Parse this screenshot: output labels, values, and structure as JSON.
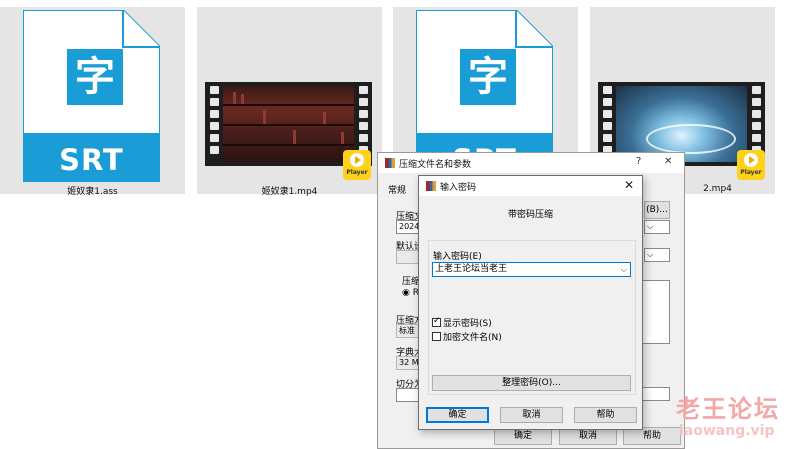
{
  "files": [
    {
      "name": "姬奴隶1.ass",
      "type_char": "字",
      "type_label": "SRT"
    },
    {
      "name": "姬奴隶1.mp4",
      "badge": "Player"
    },
    {
      "name": "",
      "type_char": "字",
      "type_label": "SRT"
    },
    {
      "name": "2.mp4",
      "badge": "Player"
    }
  ],
  "archive_dialog": {
    "title": "压缩文件名和参数",
    "help_glyph": "?",
    "close_glyph": "✕",
    "tab_general": "常规",
    "archive_name_label": "压缩文",
    "archive_name_value": "20240",
    "browse_button": "(B)...",
    "default_profile_label": "默认设",
    "format_label": "压缩",
    "format_option": "RA",
    "method_label": "压缩方",
    "method_value": "标准",
    "dict_label": "字典大",
    "dict_value": "32 MB",
    "split_label": "切分为",
    "ok_button": "确定",
    "cancel_button": "取消",
    "help_button": "帮助"
  },
  "password_dialog": {
    "title": "输入密码",
    "close_glyph": "✕",
    "heading": "带密码压缩",
    "password_label": "输入密码(E)",
    "password_value": "上老王论坛当老王",
    "show_password_label": "显示密码(S)",
    "show_password_checked": true,
    "encrypt_names_label": "加密文件名(N)",
    "encrypt_names_checked": false,
    "organize_button": "整理密码(O)...",
    "ok_button": "确定",
    "cancel_button": "取消",
    "help_button": "帮助"
  },
  "watermark": {
    "main": "老王论坛",
    "sub": "laowang.vip"
  },
  "colors": {
    "srt_blue": "#1a9dd7",
    "player_yellow": "#ffd21a",
    "focus_blue": "#0078d7",
    "watermark": "#f3a7a7"
  }
}
